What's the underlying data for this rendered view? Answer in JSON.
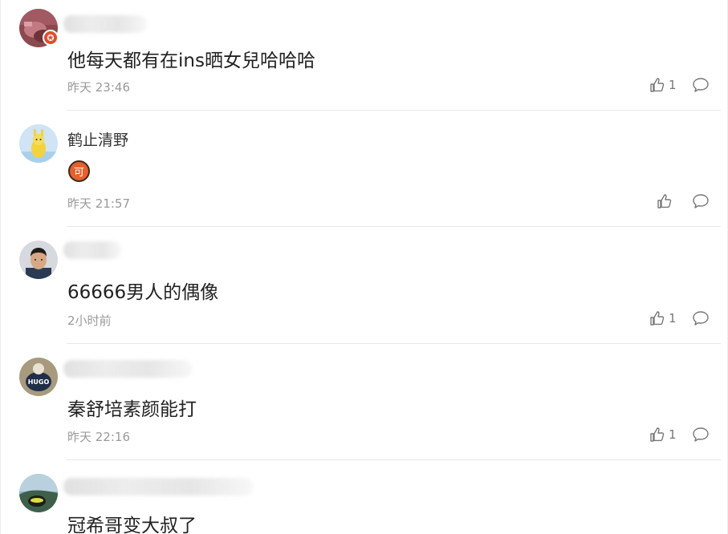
{
  "comments": [
    {
      "username": "",
      "text": "他每天都有在ins晒女兒哈哈哈",
      "time": "昨天 23:46",
      "likes": "1",
      "has_badge": true
    },
    {
      "username": "鹤止清野",
      "text": "",
      "emoji_label": "可",
      "time": "昨天 21:57",
      "likes": ""
    },
    {
      "username": "",
      "text": "66666男人的偶像",
      "time": "2小时前",
      "likes": "1"
    },
    {
      "username": "",
      "text": "秦舒培素颜能打",
      "time": "昨天 22:16",
      "likes": "1",
      "avatar_text": "HUGO"
    },
    {
      "username": "",
      "text": "冠希哥变大叔了",
      "time": "",
      "likes": ""
    }
  ],
  "icons": {
    "like": "thumbs-up-icon",
    "reply": "speech-bubble-icon",
    "badge": "star-badge-icon"
  },
  "colors": {
    "badge": "#e8492b",
    "emoji": "#e8602a",
    "time": "#9a9a9a",
    "icon": "#777777"
  }
}
